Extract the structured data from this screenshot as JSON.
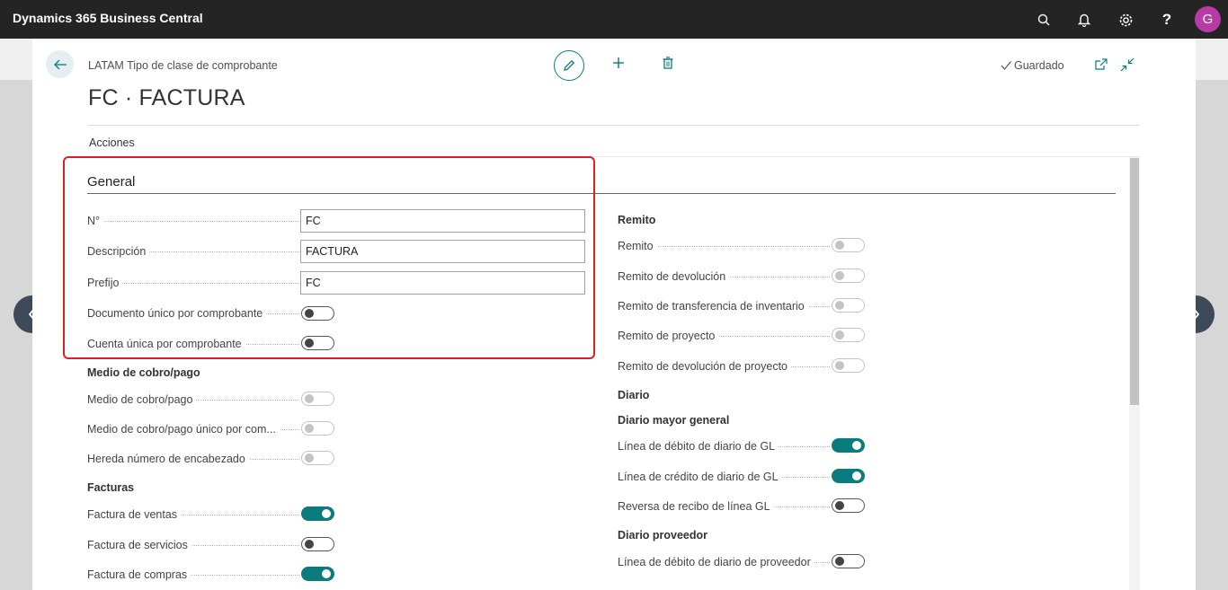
{
  "app": {
    "title": "Dynamics 365 Business Central",
    "avatar_initial": "G"
  },
  "header": {
    "breadcrumb": "LATAM Tipo de clase de comprobante",
    "title": "FC · FACTURA",
    "status": "Guardado",
    "actions_label": "Acciones"
  },
  "general": {
    "title": "General",
    "no_label": "N°",
    "no_value": "FC",
    "desc_label": "Descripción",
    "desc_value": "FACTURA",
    "prefix_label": "Prefijo",
    "prefix_value": "FC",
    "doc_unico_label": "Documento único por comprobante",
    "doc_unico": false,
    "cuenta_unica_label": "Cuenta única por comprobante",
    "cuenta_unica": false
  },
  "medio": {
    "title": "Medio de cobro/pago",
    "medio_label": "Medio de cobro/pago",
    "medio_unico_label": "Medio de cobro/pago único por com...",
    "hereda_label": "Hereda número de encabezado"
  },
  "facturas": {
    "title": "Facturas",
    "ventas_label": "Factura de ventas",
    "ventas": true,
    "servicios_label": "Factura de servicios",
    "servicios": false,
    "compras_label": "Factura de compras",
    "compras": true
  },
  "remito": {
    "title": "Remito",
    "remito_label": "Remito",
    "devolucion_label": "Remito de devolución",
    "transferencia_label": "Remito de transferencia de inventario",
    "proyecto_label": "Remito de proyecto",
    "dev_proyecto_label": "Remito de devolución de proyecto"
  },
  "diario": {
    "title": "Diario",
    "mayor_title": "Diario mayor general",
    "debito_gl_label": "Línea de débito de diario de GL",
    "debito_gl": true,
    "credito_gl_label": "Línea de crédito de diario de GL",
    "credito_gl": true,
    "reversa_label": "Reversa de recibo de línea GL",
    "reversa": false,
    "proveedor_title": "Diario proveedor",
    "debito_prov_label": "Línea de débito de diario de proveedor",
    "debito_prov": false
  },
  "colors": {
    "accent": "#0b7c7d",
    "topbar": "#242424",
    "avatar": "#b83ba5",
    "highlight": "#e02020"
  }
}
